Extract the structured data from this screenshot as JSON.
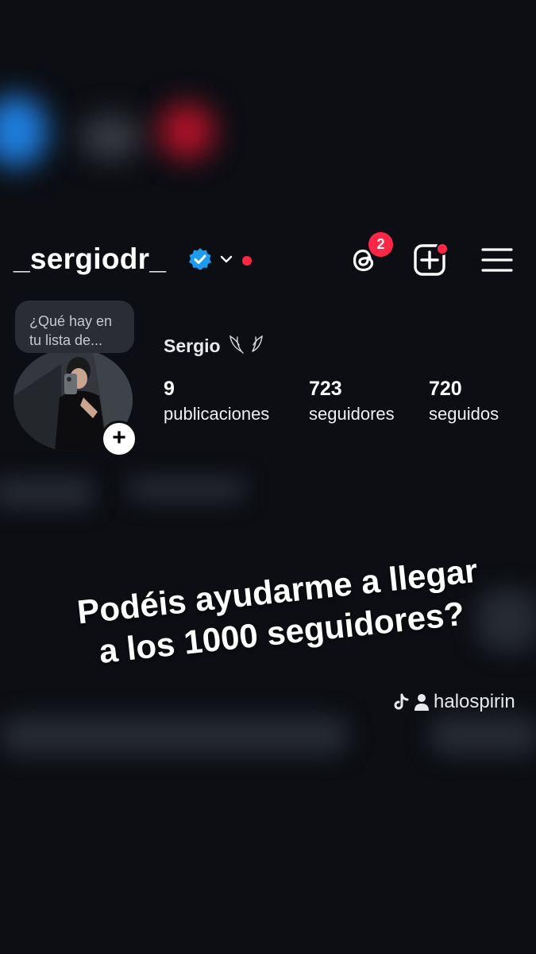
{
  "header": {
    "username": "_sergiodr_",
    "threads_badge": "2"
  },
  "profile": {
    "note_line1": "¿Qué hay en",
    "note_line2": "tu lista de...",
    "display_name": "Sergio",
    "stats": [
      {
        "value": "9",
        "label": "publicaciones"
      },
      {
        "value": "723",
        "label": "seguidores"
      },
      {
        "value": "720",
        "label": "seguidos"
      }
    ],
    "add_story": "+"
  },
  "caption": {
    "line1": "Podéis ayudarme a llegar",
    "line2": "a los 1000 seguidores?"
  },
  "watermark": {
    "handle": "halospirin"
  },
  "colors": {
    "background": "#0c0e13",
    "verified": "#1d9bf0",
    "notification": "#ff2745"
  }
}
